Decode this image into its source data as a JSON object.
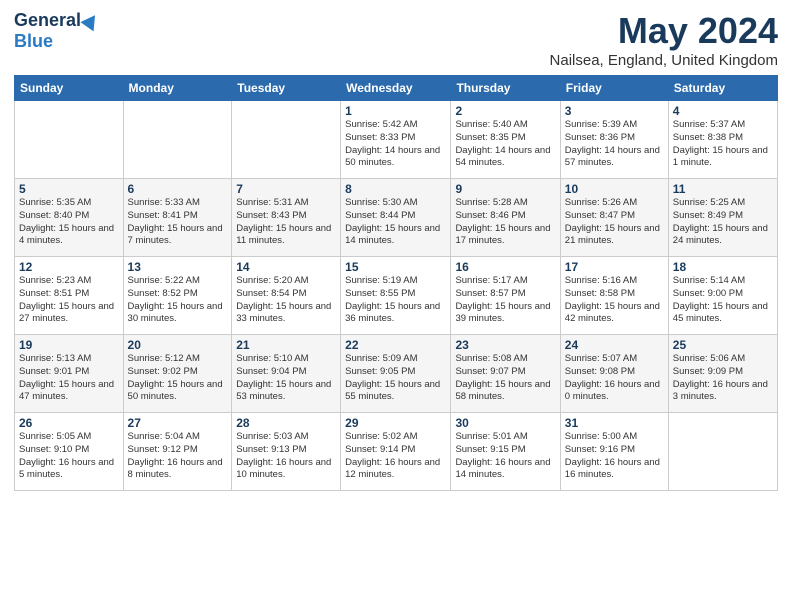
{
  "logo": {
    "general": "General",
    "blue": "Blue"
  },
  "title": "May 2024",
  "location": "Nailsea, England, United Kingdom",
  "weekdays": [
    "Sunday",
    "Monday",
    "Tuesday",
    "Wednesday",
    "Thursday",
    "Friday",
    "Saturday"
  ],
  "weeks": [
    [
      {
        "date": "",
        "sunrise": "",
        "sunset": "",
        "daylight": ""
      },
      {
        "date": "",
        "sunrise": "",
        "sunset": "",
        "daylight": ""
      },
      {
        "date": "",
        "sunrise": "",
        "sunset": "",
        "daylight": ""
      },
      {
        "date": "1",
        "sunrise": "Sunrise: 5:42 AM",
        "sunset": "Sunset: 8:33 PM",
        "daylight": "Daylight: 14 hours and 50 minutes."
      },
      {
        "date": "2",
        "sunrise": "Sunrise: 5:40 AM",
        "sunset": "Sunset: 8:35 PM",
        "daylight": "Daylight: 14 hours and 54 minutes."
      },
      {
        "date": "3",
        "sunrise": "Sunrise: 5:39 AM",
        "sunset": "Sunset: 8:36 PM",
        "daylight": "Daylight: 14 hours and 57 minutes."
      },
      {
        "date": "4",
        "sunrise": "Sunrise: 5:37 AM",
        "sunset": "Sunset: 8:38 PM",
        "daylight": "Daylight: 15 hours and 1 minute."
      }
    ],
    [
      {
        "date": "5",
        "sunrise": "Sunrise: 5:35 AM",
        "sunset": "Sunset: 8:40 PM",
        "daylight": "Daylight: 15 hours and 4 minutes."
      },
      {
        "date": "6",
        "sunrise": "Sunrise: 5:33 AM",
        "sunset": "Sunset: 8:41 PM",
        "daylight": "Daylight: 15 hours and 7 minutes."
      },
      {
        "date": "7",
        "sunrise": "Sunrise: 5:31 AM",
        "sunset": "Sunset: 8:43 PM",
        "daylight": "Daylight: 15 hours and 11 minutes."
      },
      {
        "date": "8",
        "sunrise": "Sunrise: 5:30 AM",
        "sunset": "Sunset: 8:44 PM",
        "daylight": "Daylight: 15 hours and 14 minutes."
      },
      {
        "date": "9",
        "sunrise": "Sunrise: 5:28 AM",
        "sunset": "Sunset: 8:46 PM",
        "daylight": "Daylight: 15 hours and 17 minutes."
      },
      {
        "date": "10",
        "sunrise": "Sunrise: 5:26 AM",
        "sunset": "Sunset: 8:47 PM",
        "daylight": "Daylight: 15 hours and 21 minutes."
      },
      {
        "date": "11",
        "sunrise": "Sunrise: 5:25 AM",
        "sunset": "Sunset: 8:49 PM",
        "daylight": "Daylight: 15 hours and 24 minutes."
      }
    ],
    [
      {
        "date": "12",
        "sunrise": "Sunrise: 5:23 AM",
        "sunset": "Sunset: 8:51 PM",
        "daylight": "Daylight: 15 hours and 27 minutes."
      },
      {
        "date": "13",
        "sunrise": "Sunrise: 5:22 AM",
        "sunset": "Sunset: 8:52 PM",
        "daylight": "Daylight: 15 hours and 30 minutes."
      },
      {
        "date": "14",
        "sunrise": "Sunrise: 5:20 AM",
        "sunset": "Sunset: 8:54 PM",
        "daylight": "Daylight: 15 hours and 33 minutes."
      },
      {
        "date": "15",
        "sunrise": "Sunrise: 5:19 AM",
        "sunset": "Sunset: 8:55 PM",
        "daylight": "Daylight: 15 hours and 36 minutes."
      },
      {
        "date": "16",
        "sunrise": "Sunrise: 5:17 AM",
        "sunset": "Sunset: 8:57 PM",
        "daylight": "Daylight: 15 hours and 39 minutes."
      },
      {
        "date": "17",
        "sunrise": "Sunrise: 5:16 AM",
        "sunset": "Sunset: 8:58 PM",
        "daylight": "Daylight: 15 hours and 42 minutes."
      },
      {
        "date": "18",
        "sunrise": "Sunrise: 5:14 AM",
        "sunset": "Sunset: 9:00 PM",
        "daylight": "Daylight: 15 hours and 45 minutes."
      }
    ],
    [
      {
        "date": "19",
        "sunrise": "Sunrise: 5:13 AM",
        "sunset": "Sunset: 9:01 PM",
        "daylight": "Daylight: 15 hours and 47 minutes."
      },
      {
        "date": "20",
        "sunrise": "Sunrise: 5:12 AM",
        "sunset": "Sunset: 9:02 PM",
        "daylight": "Daylight: 15 hours and 50 minutes."
      },
      {
        "date": "21",
        "sunrise": "Sunrise: 5:10 AM",
        "sunset": "Sunset: 9:04 PM",
        "daylight": "Daylight: 15 hours and 53 minutes."
      },
      {
        "date": "22",
        "sunrise": "Sunrise: 5:09 AM",
        "sunset": "Sunset: 9:05 PM",
        "daylight": "Daylight: 15 hours and 55 minutes."
      },
      {
        "date": "23",
        "sunrise": "Sunrise: 5:08 AM",
        "sunset": "Sunset: 9:07 PM",
        "daylight": "Daylight: 15 hours and 58 minutes."
      },
      {
        "date": "24",
        "sunrise": "Sunrise: 5:07 AM",
        "sunset": "Sunset: 9:08 PM",
        "daylight": "Daylight: 16 hours and 0 minutes."
      },
      {
        "date": "25",
        "sunrise": "Sunrise: 5:06 AM",
        "sunset": "Sunset: 9:09 PM",
        "daylight": "Daylight: 16 hours and 3 minutes."
      }
    ],
    [
      {
        "date": "26",
        "sunrise": "Sunrise: 5:05 AM",
        "sunset": "Sunset: 9:10 PM",
        "daylight": "Daylight: 16 hours and 5 minutes."
      },
      {
        "date": "27",
        "sunrise": "Sunrise: 5:04 AM",
        "sunset": "Sunset: 9:12 PM",
        "daylight": "Daylight: 16 hours and 8 minutes."
      },
      {
        "date": "28",
        "sunrise": "Sunrise: 5:03 AM",
        "sunset": "Sunset: 9:13 PM",
        "daylight": "Daylight: 16 hours and 10 minutes."
      },
      {
        "date": "29",
        "sunrise": "Sunrise: 5:02 AM",
        "sunset": "Sunset: 9:14 PM",
        "daylight": "Daylight: 16 hours and 12 minutes."
      },
      {
        "date": "30",
        "sunrise": "Sunrise: 5:01 AM",
        "sunset": "Sunset: 9:15 PM",
        "daylight": "Daylight: 16 hours and 14 minutes."
      },
      {
        "date": "31",
        "sunrise": "Sunrise: 5:00 AM",
        "sunset": "Sunset: 9:16 PM",
        "daylight": "Daylight: 16 hours and 16 minutes."
      },
      {
        "date": "",
        "sunrise": "",
        "sunset": "",
        "daylight": ""
      }
    ]
  ]
}
